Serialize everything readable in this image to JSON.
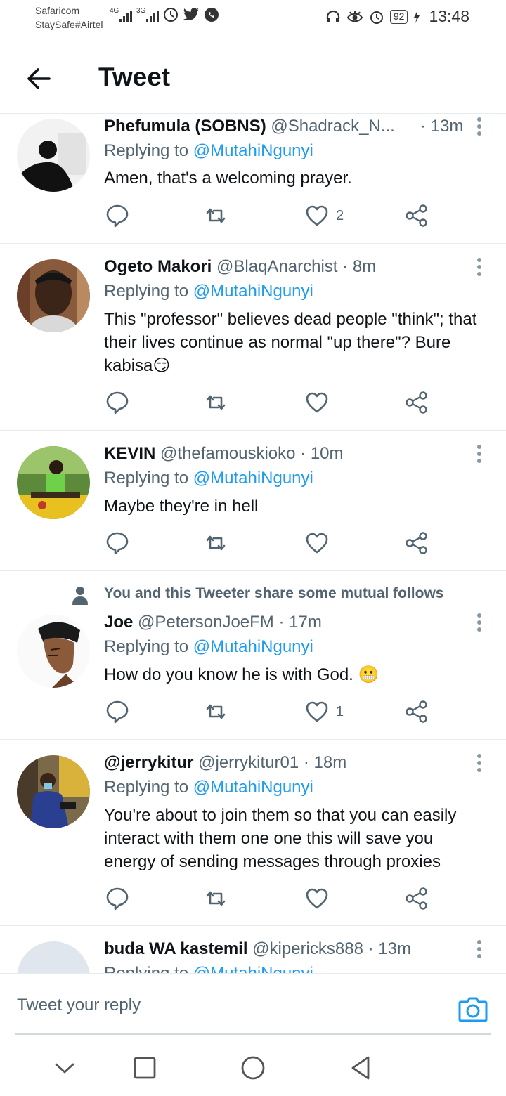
{
  "status_bar": {
    "carrier_line1": "Safaricom",
    "carrier_line2": "StaySafe#Airtel",
    "signal1_label": "4G",
    "signal2_label": "3G",
    "battery": "92",
    "time": "13:48"
  },
  "header": {
    "title": "Tweet",
    "back_icon": "arrow-left-icon"
  },
  "replying_label": "Replying to",
  "tweets": [
    {
      "name": "Phefumula (SOBNS)",
      "handle": "@Shadrack_N...",
      "time": "· 13m",
      "replying_to": "@MutahiNgunyi",
      "text": "Amen, that's a welcoming prayer.",
      "like_count": "2"
    },
    {
      "name": "Ogeto Makori",
      "handle": "@BlaqAnarchist",
      "time": "· 8m",
      "replying_to": "@MutahiNgunyi",
      "text": "This \"professor\" believes dead people \"think\"; that their lives continue as normal \"up there\"? Bure kabisa😏",
      "like_count": ""
    },
    {
      "name": "KEVIN",
      "handle": "@thefamouskioko",
      "time": "· 10m",
      "replying_to": "@MutahiNgunyi",
      "text": "Maybe they're in hell",
      "like_count": ""
    },
    {
      "mutual_note": "You and this Tweeter share some mutual follows",
      "name": "Joe",
      "handle": "@PetersonJoeFM",
      "time": "· 17m",
      "replying_to": "@MutahiNgunyi",
      "text": "How do you know he is with God. 😬",
      "like_count": "1"
    },
    {
      "name": "@jerrykitur",
      "handle": "@jerrykitur01",
      "time": "· 18m",
      "replying_to": "@MutahiNgunyi",
      "text": "You're about to join them so that you can easily interact with them one one this will save you energy of sending messages through proxies",
      "like_count": ""
    },
    {
      "name": "buda WA kastemil",
      "handle": "@kipericks888",
      "time": "· 13m",
      "replying_to": "@MutahiNgunyi"
    }
  ],
  "composer": {
    "placeholder": "Tweet your reply",
    "camera_icon": "camera-icon"
  },
  "colors": {
    "accent": "#1d9bf0",
    "text_secondary": "#536471",
    "divider": "#e6ecf0"
  }
}
